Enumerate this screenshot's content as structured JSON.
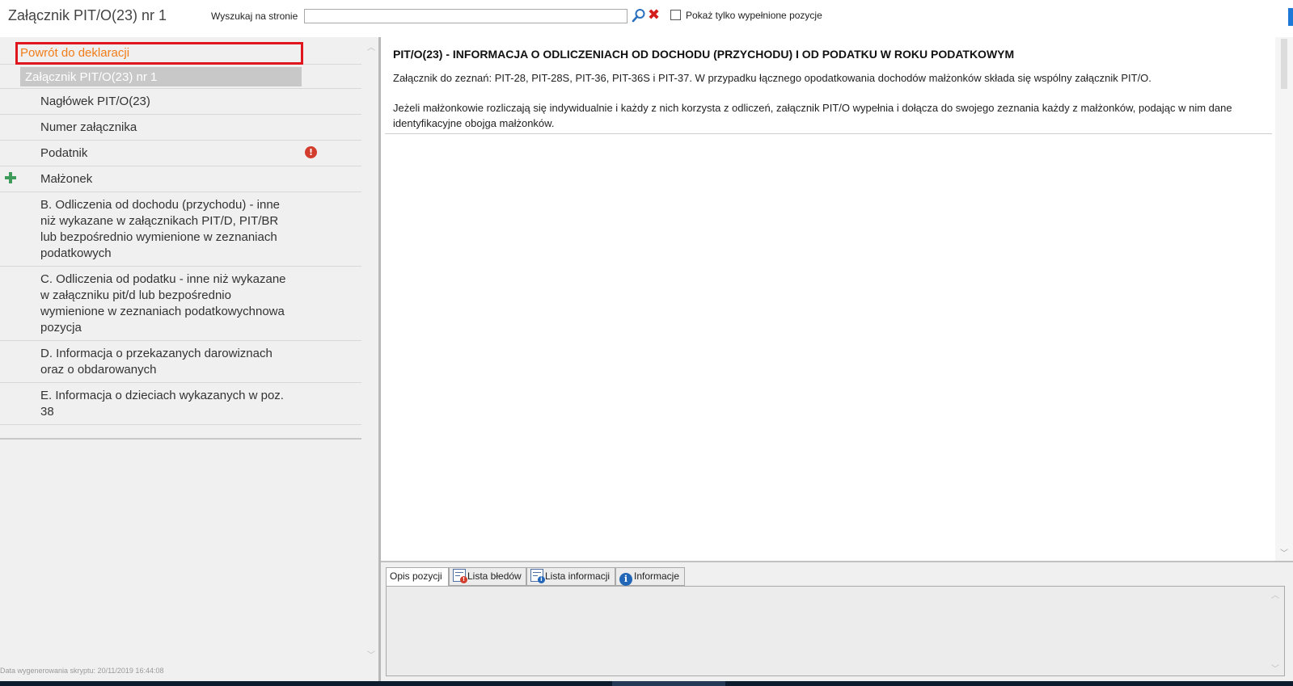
{
  "header": {
    "title": "Załącznik PIT/O(23) nr 1",
    "search_label": "Wyszukaj na stronie",
    "search_value": "",
    "search_placeholder": "",
    "clear_symbol": "✖",
    "filled_only_label": "Pokaż tylko wypełnione pozycje"
  },
  "sidebar": {
    "back_label": "Powrót do deklaracji",
    "current_label": "Załącznik PIT/O(23) nr 1",
    "items": [
      {
        "label": "Nagłówek PIT/O(23)"
      },
      {
        "label": "Numer załącznika"
      },
      {
        "label": "Podatnik",
        "error_symbol": "!"
      },
      {
        "label": "Małżonek"
      },
      {
        "label": "B. Odliczenia od dochodu (przychodu) - inne niż wykazane w załącznikach PIT/D, PIT/BR lub bezpośrednio wymienione w zeznaniach podatkowych"
      },
      {
        "label": "C. Odliczenia od podatku - inne niż wykazane w załączniku pit/d lub bezpośrednio wymienione w zeznaniach podatkowychnowa pozycja"
      },
      {
        "label": "D. Informacja o przekazanych darowiznach oraz o obdarowanych"
      },
      {
        "label": "E. Informacja o dzieciach wykazanych w poz. 38"
      }
    ],
    "generated_label": "Data wygenerowania skryptu: 20/11/2019 16:44:08"
  },
  "content": {
    "title": "PIT/O(23) - INFORMACJA O ODLICZENIACH OD DOCHODU (PRZYCHODU) I OD PODATKU W ROKU PODATKOWYM",
    "paragraph1": "Załącznik do zeznań: PIT-28, PIT-28S, PIT-36, PIT-36S i PIT-37. W przypadku łącznego opodatkowania dochodów małżonków składa się wspólny załącznik PIT/O.",
    "paragraph2": "Jeżeli małżonkowie rozliczają się indywidualnie i każdy z nich korzysta z odliczeń, załącznik PIT/O wypełnia i dołącza do swojego zeznania każdy z małżonków, podając w nim dane identyfikacyjne obojga małżonków."
  },
  "bottom_tabs": {
    "tabs": [
      {
        "label": "Opis pozycji",
        "active": true
      },
      {
        "label": "Lista błedów",
        "badge": "!"
      },
      {
        "label": "Lista informacji",
        "badge": "i"
      },
      {
        "label": "Informacje",
        "badge": "i"
      }
    ],
    "panel_text": ""
  },
  "icons": {
    "search": "magnifier-icon",
    "clear": "close-x-icon",
    "add": "plus-icon",
    "error": "error-icon",
    "list": "list-icon",
    "info": "info-icon"
  },
  "colors": {
    "back_link": "#f07d1a",
    "back_highlight": "#e0161f",
    "plus": "#3f9b5a",
    "error": "#d33d2e",
    "clear_x": "#d31c1c",
    "search_icon": "#2a6ebd",
    "info_icon": "#2266b8"
  }
}
